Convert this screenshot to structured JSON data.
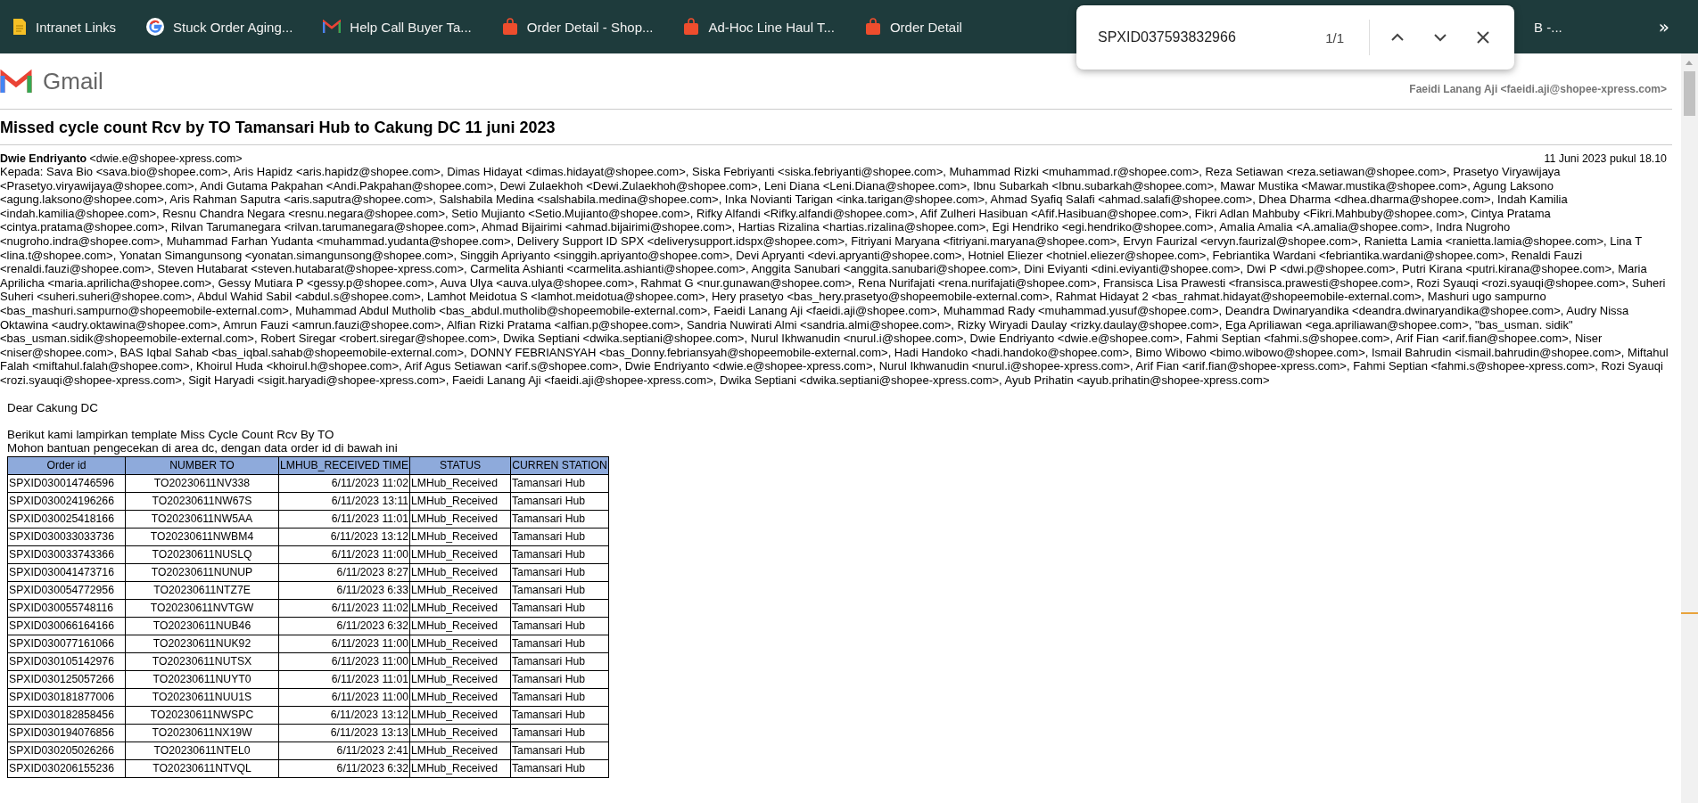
{
  "bookmarks": [
    {
      "kind": "page",
      "label": "Intranet Links"
    },
    {
      "kind": "google",
      "label": "Stuck Order Aging..."
    },
    {
      "kind": "gmail",
      "label": "Help Call Buyer Ta..."
    },
    {
      "kind": "shop",
      "label": "Order Detail - Shop..."
    },
    {
      "kind": "shop",
      "label": "Ad-Hoc Line Haul T..."
    },
    {
      "kind": "shop",
      "label": "Order Detail"
    },
    {
      "kind": "partial",
      "label": "B -..."
    }
  ],
  "overflow": "»",
  "find_bar": {
    "value": "SPXID037593832966",
    "count": "1/1"
  },
  "header": {
    "brand": "Gmail",
    "account": "Faeidi Lanang Aji <faeidi.aji@shopee-xpress.com>"
  },
  "subject": "Missed cycle count Rcv by TO Tamansari Hub to Cakung DC 11 juni 2023",
  "message": {
    "sender_name": "Dwie Endriyanto",
    "sender_email": "<dwie.e@shopee-xpress.com>",
    "date": "11 Juni 2023 pukul 18.10",
    "recipients": [
      "Kepada: Sava Bio <sava.bio@shopee.com>, Aris Hapidz <aris.hapidz@shopee.com>, Dimas Hidayat <dimas.hidayat@shopee.com>, Siska Febriyanti <siska.febriyanti@shopee.com>, Muhammad Rizki <muhammad.r@shopee.com>, Reza Setiawan <reza.setiawan@shopee.com>, Prasetyo Viryawijaya",
      "<Prasetyo.viryawijaya@shopee.com>, Andi Gutama Pakpahan <Andi.Pakpahan@shopee.com>, Dewi Zulaekhoh <Dewi.Zulaekhoh@shopee.com>, Leni Diana <Leni.Diana@shopee.com>, Ibnu Subarkah <Ibnu.subarkah@shopee.com>, Mawar Mustika <Mawar.mustika@shopee.com>, Agung Laksono",
      "<agung.laksono@shopee.com>, Aris Rahman Saputra <aris.saputra@shopee.com>, Salshabila Medina <salshabila.medina@shopee.com>, Inka Novianti Tarigan <inka.tarigan@shopee.com>, Ahmad Syafiq Salafi <ahmad.salafi@shopee.com>, Dhea Dharma <dhea.dharma@shopee.com>, Indah Kamilia",
      "<indah.kamilia@shopee.com>, Resnu Chandra Negara <resnu.negara@shopee.com>, Setio Mujianto <Setio.Mujianto@shopee.com>, Rifky Alfandi <Rifky.alfandi@shopee.com>, Afif Zulheri Hasibuan <Afif.Hasibuan@shopee.com>, Fikri Adlan Mahbuby <Fikri.Mahbuby@shopee.com>, Cintya Pratama",
      "<cintya.pratama@shopee.com>, Rilvan Tarumanegara <rilvan.tarumanegara@shopee.com>, Ahmad Bijairimi <ahmad.bijairimi@shopee.com>, Hartias Rizalina <hartias.rizalina@shopee.com>, Egi Hendriko <egi.hendriko@shopee.com>, Amalia Amalia <A.amalia@shopee.com>, Indra Nugroho",
      "<nugroho.indra@shopee.com>, Muhammad Farhan Yudanta <muhammad.yudanta@shopee.com>, Delivery Support ID SPX <deliverysupport.idspx@shopee.com>, Fitriyani Maryana <fitriyani.maryana@shopee.com>, Ervyn Faurizal <ervyn.faurizal@shopee.com>, Ranietta Lamia <ranietta.lamia@shopee.com>, Lina T",
      "<lina.t@shopee.com>, Yonatan Simangunsong <yonatan.simangunsong@shopee.com>, Singgih Apriyanto <singgih.apriyanto@shopee.com>, Devi Apryanti <devi.apryanti@shopee.com>, Hotniel Eliezer <hotniel.eliezer@shopee.com>, Febriantika Wardani <febriantika.wardani@shopee.com>, Renaldi Fauzi",
      "<renaldi.fauzi@shopee.com>, Steven Hutabarat <steven.hutabarat@shopee-xpress.com>, Carmelita Ashianti <carmelita.ashianti@shopee.com>, Anggita Sanubari <anggita.sanubari@shopee.com>, Dini Eviyanti <dini.eviyanti@shopee.com>, Dwi P <dwi.p@shopee.com>, Putri Kirana <putri.kirana@shopee.com>, Maria",
      "Aprilicha <maria.aprilicha@shopee.com>, Gessy Mutiara P <gessy.p@shopee.com>, Auva Ulya <auva.ulya@shopee.com>, Rahmat G <nur.gunawan@shopee.com>, Rena Nurifajati <rena.nurifajati@shopee.com>, Fransisca Lisa Prawesti <fransisca.prawesti@shopee.com>, Rozi Syauqi <rozi.syauqi@shopee.com>, Suheri",
      "Suheri <suheri.suheri@shopee.com>, Abdul Wahid Sabil <abdul.s@shopee.com>, Lamhot Meidotua S <lamhot.meidotua@shopee.com>, Hery prasetyo <bas_hery.prasetyo@shopeemobile-external.com>, Rahmat Hidayat 2 <bas_rahmat.hidayat@shopeemobile-external.com>, Mashuri ugo sampurno",
      "<bas_mashuri.sampurno@shopeemobile-external.com>, Muhammad Abdul Mutholib <bas_abdul.mutholib@shopeemobile-external.com>, Faeidi Lanang Aji <faeidi.aji@shopee.com>, Muhammad Rady <muhammad.yusuf@shopee.com>, Deandra Dwinaryandika <deandra.dwinaryandika@shopee.com>, Audry Nissa",
      "Oktawina <audry.oktawina@shopee.com>, Amrun Fauzi <amrun.fauzi@shopee.com>, Alfian Rizki Pratama <alfian.p@shopee.com>, Sandria Nuwirati Almi <sandria.almi@shopee.com>, Rizky Wiryadi Daulay <rizky.daulay@shopee.com>, Ega Apriliawan <ega.apriliawan@shopee.com>, \"bas_usman. sidik\"",
      "<bas_usman.sidik@shopeemobile-external.com>, Robert Siregar <robert.siregar@shopee.com>, Dwika Septiani <dwika.septiani@shopee.com>, Nurul Ikhwanudin <nurul.i@shopee.com>, Dwie Endriyanto <dwie.e@shopee.com>, Fahmi Septian <fahmi.s@shopee.com>, Arif Fian <arif.fian@shopee.com>, Niser",
      "<niser@shopee.com>, BAS Iqbal Sahab <bas_iqbal.sahab@shopeemobile-external.com>, DONNY FEBRIANSYAH <bas_Donny.febriansyah@shopeemobile-external.com>, Hadi Handoko <hadi.handoko@shopee.com>, Bimo Wibowo <bimo.wibowo@shopee.com>, Ismail Bahrudin <ismail.bahrudin@shopee.com>, Miftahul",
      "Falah <miftahul.falah@shopee.com>, Khoirul Huda <khoirul.h@shopee.com>, Arif Agus Setiawan <arif.s@shopee.com>, Dwie Endriyanto <dwie.e@shopee-xpress.com>, Nurul Ikhwanudin <nurul.i@shopee-xpress.com>, Arif Fian <arif.fian@shopee-xpress.com>, Fahmi Septian <fahmi.s@shopee-xpress.com>, Rozi Syauqi",
      "<rozi.syauqi@shopee-xpress.com>, Sigit Haryadi <sigit.haryadi@shopee-xpress.com>, Faeidi Lanang Aji <faeidi.aji@shopee-xpress.com>, Dwika Septiani <dwika.septiani@shopee-xpress.com>, Ayub Prihatin <ayub.prihatin@shopee-xpress.com>"
    ],
    "greeting": "Dear Cakung DC",
    "body": [
      "Berikut kami lampirkan template Miss Cycle Count Rcv By TO",
      "Mohon bantuan pengecekan di area dc, dengan data order id di bawah ini"
    ]
  },
  "table": {
    "columns": [
      "Order id",
      "NUMBER TO",
      "LMHUB_RECEIVED TIME",
      "STATUS",
      "CURREN STATION"
    ],
    "rows": [
      [
        "SPXID030014746596",
        "TO20230611NV338",
        "6/11/2023 11:02",
        "LMHub_Received",
        "Tamansari Hub"
      ],
      [
        "SPXID030024196266",
        "TO20230611NW67S",
        "6/11/2023 13:11",
        "LMHub_Received",
        "Tamansari Hub"
      ],
      [
        "SPXID030025418166",
        "TO20230611NW5AA",
        "6/11/2023 11:01",
        "LMHub_Received",
        "Tamansari Hub"
      ],
      [
        "SPXID030033033736",
        "TO20230611NWBM4",
        "6/11/2023 13:12",
        "LMHub_Received",
        "Tamansari Hub"
      ],
      [
        "SPXID030033743366",
        "TO20230611NUSLQ",
        "6/11/2023 11:00",
        "LMHub_Received",
        "Tamansari Hub"
      ],
      [
        "SPXID030041473716",
        "TO20230611NUNUP",
        "6/11/2023 8:27",
        "LMHub_Received",
        "Tamansari Hub"
      ],
      [
        "SPXID030054772956",
        "TO20230611NTZ7E",
        "6/11/2023 6:33",
        "LMHub_Received",
        "Tamansari Hub"
      ],
      [
        "SPXID030055748116",
        "TO20230611NVTGW",
        "6/11/2023 11:02",
        "LMHub_Received",
        "Tamansari Hub"
      ],
      [
        "SPXID030066164166",
        "TO20230611NUB46",
        "6/11/2023 6:32",
        "LMHub_Received",
        "Tamansari Hub"
      ],
      [
        "SPXID030077161066",
        "TO20230611NUK92",
        "6/11/2023 11:00",
        "LMHub_Received",
        "Tamansari Hub"
      ],
      [
        "SPXID030105142976",
        "TO20230611NUTSX",
        "6/11/2023 11:00",
        "LMHub_Received",
        "Tamansari Hub"
      ],
      [
        "SPXID030125057266",
        "TO20230611NUYT0",
        "6/11/2023 11:01",
        "LMHub_Received",
        "Tamansari Hub"
      ],
      [
        "SPXID030181877006",
        "TO20230611NUU1S",
        "6/11/2023 11:00",
        "LMHub_Received",
        "Tamansari Hub"
      ],
      [
        "SPXID030182858456",
        "TO20230611NWSPC",
        "6/11/2023 13:12",
        "LMHub_Received",
        "Tamansari Hub"
      ],
      [
        "SPXID030194076856",
        "TO20230611NX19W",
        "6/11/2023 13:13",
        "LMHub_Received",
        "Tamansari Hub"
      ],
      [
        "SPXID030205026266",
        "TO20230611NTEL0",
        "6/11/2023 2:41",
        "LMHub_Received",
        "Tamansari Hub"
      ],
      [
        "SPXID030206155236",
        "TO20230611NTVQL",
        "6/11/2023 6:32",
        "LMHub_Received",
        "Tamansari Hub"
      ]
    ]
  }
}
